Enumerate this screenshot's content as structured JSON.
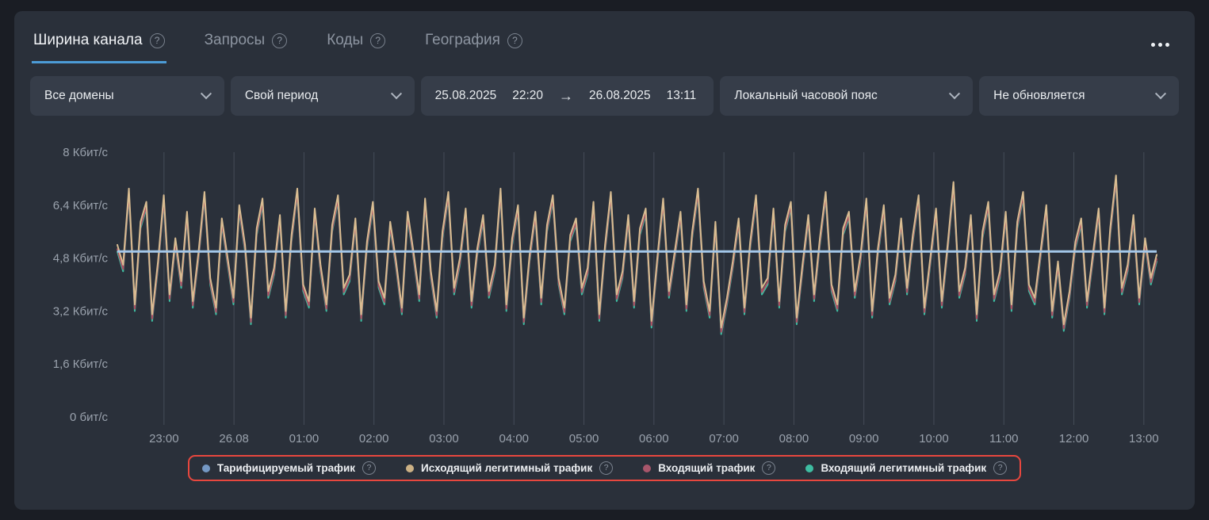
{
  "tabs": [
    {
      "label": "Ширина канала",
      "active": true
    },
    {
      "label": "Запросы",
      "active": false
    },
    {
      "label": "Коды",
      "active": false
    },
    {
      "label": "География",
      "active": false
    }
  ],
  "filters": {
    "domain": "Все домены",
    "period": "Свой период",
    "range": {
      "from_date": "25.08.2025",
      "from_time": "22:20",
      "arrow": "→",
      "to_date": "26.08.2025",
      "to_time": "13:11"
    },
    "timezone": "Локальный часовой пояс",
    "refresh": "Не обновляется"
  },
  "legend": {
    "items": [
      {
        "label": "Тарифицируемый трафик",
        "color": "#7498c4"
      },
      {
        "label": "Исходящий легитимный трафик",
        "color": "#ccb185"
      },
      {
        "label": "Входящий трафик",
        "color": "#a8566b"
      },
      {
        "label": "Входящий легитимный трафик",
        "color": "#3ebda2"
      }
    ]
  },
  "chart_data": {
    "type": "line",
    "title": "Ширина канала",
    "x_start": "25.08.2025 22:20",
    "x_end": "26.08.2025 13:11",
    "x_total_minutes": 891,
    "x_tick_first_minute": 40,
    "x_tick_step_minutes": 60,
    "x_tick_labels": [
      "23:00",
      "26.08",
      "01:00",
      "02:00",
      "03:00",
      "04:00",
      "05:00",
      "06:00",
      "07:00",
      "08:00",
      "09:00",
      "10:00",
      "11:00",
      "12:00",
      "13:00"
    ],
    "y_unit": "Кбит/с",
    "ylim": [
      0,
      8
    ],
    "y_ticks": [
      {
        "value": 8,
        "label": "8 Кбит/с"
      },
      {
        "value": 6.4,
        "label": "6,4 Кбит/с"
      },
      {
        "value": 4.8,
        "label": "4,8 Кбит/с"
      },
      {
        "value": 3.2,
        "label": "3,2 Кбит/с"
      },
      {
        "value": 1.6,
        "label": "1,6 Кбит/с"
      },
      {
        "value": 0,
        "label": "0 бит/с"
      }
    ],
    "grid": "vertical-only",
    "legend_position": "bottom-center",
    "gridline_color": "#454c58",
    "series": [
      {
        "name": "Входящий легитимный трафик",
        "color": "#3ebda2",
        "derived_from": "Исходящий легитимный трафик",
        "offset": -0.2
      },
      {
        "name": "Входящий трафик",
        "color": "#ad4f63",
        "derived_from": "Исходящий легитимный трафик",
        "offset": -0.13
      },
      {
        "name": "Исходящий легитимный трафик",
        "color": "#d9bd92",
        "interval_minutes": 5,
        "values": [
          5.2,
          4.6,
          6.9,
          3.4,
          5.9,
          6.5,
          3.1,
          4.7,
          6.7,
          3.7,
          5.4,
          4.1,
          6.2,
          3.5,
          5.0,
          6.8,
          4.2,
          3.3,
          6.0,
          4.8,
          3.6,
          6.4,
          5.2,
          3.0,
          5.7,
          6.6,
          3.8,
          4.5,
          6.1,
          3.2,
          5.5,
          6.9,
          4.0,
          3.5,
          6.3,
          4.6,
          3.4,
          5.8,
          6.7,
          3.9,
          4.3,
          6.0,
          3.1,
          5.3,
          6.5,
          4.1,
          3.6,
          5.9,
          4.7,
          3.3,
          6.2,
          5.0,
          3.7,
          6.6,
          4.4,
          3.2,
          5.6,
          6.8,
          3.9,
          4.8,
          6.3,
          3.5,
          5.1,
          6.1,
          3.8,
          4.6,
          6.9,
          3.4,
          5.4,
          6.4,
          3.0,
          4.9,
          6.2,
          3.6,
          5.8,
          6.7,
          4.2,
          3.3,
          5.5,
          6.0,
          3.9,
          4.5,
          6.5,
          3.1,
          5.2,
          6.8,
          3.7,
          4.4,
          6.1,
          3.5,
          5.7,
          6.3,
          2.9,
          4.8,
          6.6,
          3.8,
          5.0,
          6.2,
          3.4,
          5.6,
          6.9,
          4.1,
          3.2,
          5.9,
          2.7,
          3.6,
          4.7,
          6.0,
          3.3,
          5.3,
          6.7,
          3.9,
          4.2,
          6.3,
          3.5,
          5.8,
          6.5,
          3.0,
          4.6,
          6.1,
          3.7,
          5.4,
          6.8,
          4.0,
          3.4,
          5.7,
          6.2,
          3.8,
          4.9,
          6.6,
          3.2,
          5.1,
          6.4,
          3.6,
          4.3,
          6.0,
          3.9,
          5.5,
          6.7,
          3.3,
          4.8,
          6.3,
          3.5,
          5.2,
          7.1,
          3.8,
          4.5,
          6.1,
          3.1,
          5.6,
          6.5,
          3.7,
          4.4,
          6.2,
          3.4,
          5.9,
          6.8,
          4.0,
          3.6,
          5.0,
          6.4,
          3.2,
          4.7,
          2.8,
          3.8,
          5.3,
          6.0,
          3.5,
          4.9,
          6.3,
          3.3,
          5.7,
          7.3,
          3.9,
          4.6,
          6.1,
          3.6,
          5.4,
          4.2,
          4.9
        ]
      },
      {
        "name": "Тарифицируемый трафик",
        "color": "#a3c7e9",
        "constant": 5.0
      }
    ]
  }
}
